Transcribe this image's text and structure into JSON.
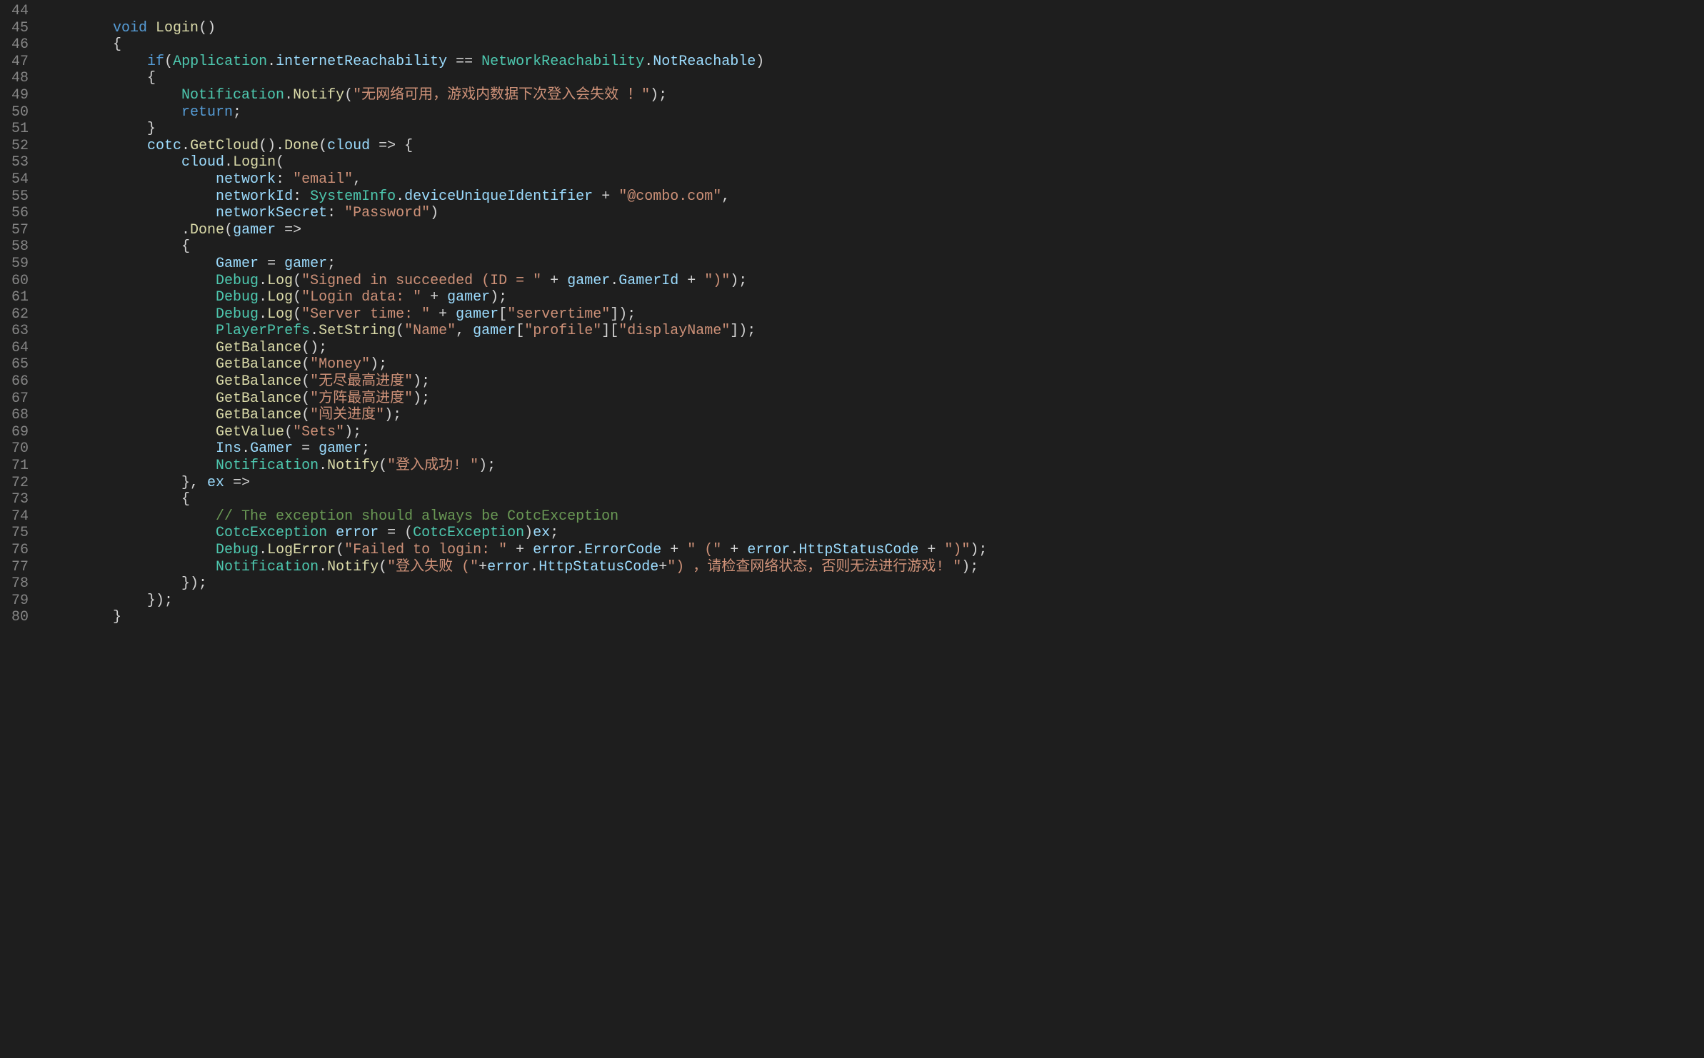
{
  "gutter": {
    "start": 44,
    "end": 80
  },
  "code": {
    "lines": [
      [
        {
          "t": "",
          "c": "punc"
        }
      ],
      [
        {
          "t": "        ",
          "c": "punc"
        },
        {
          "t": "void",
          "c": "kw"
        },
        {
          "t": " ",
          "c": "punc"
        },
        {
          "t": "Login",
          "c": "fn"
        },
        {
          "t": "()",
          "c": "punc"
        }
      ],
      [
        {
          "t": "        {",
          "c": "punc"
        }
      ],
      [
        {
          "t": "            ",
          "c": "punc"
        },
        {
          "t": "if",
          "c": "kw"
        },
        {
          "t": "(",
          "c": "punc"
        },
        {
          "t": "Application",
          "c": "type"
        },
        {
          "t": ".",
          "c": "punc"
        },
        {
          "t": "internetReachability",
          "c": "prop"
        },
        {
          "t": " == ",
          "c": "op"
        },
        {
          "t": "NetworkReachability",
          "c": "enum"
        },
        {
          "t": ".",
          "c": "punc"
        },
        {
          "t": "NotReachable",
          "c": "enumval"
        },
        {
          "t": ")",
          "c": "punc"
        }
      ],
      [
        {
          "t": "            {",
          "c": "punc"
        }
      ],
      [
        {
          "t": "                ",
          "c": "punc"
        },
        {
          "t": "Notification",
          "c": "type"
        },
        {
          "t": ".",
          "c": "punc"
        },
        {
          "t": "Notify",
          "c": "fn"
        },
        {
          "t": "(",
          "c": "punc"
        },
        {
          "t": "\"无网络可用，游戏内数据下次登入会失效 ！\"",
          "c": "str"
        },
        {
          "t": ");",
          "c": "punc"
        }
      ],
      [
        {
          "t": "                ",
          "c": "punc"
        },
        {
          "t": "return",
          "c": "kw"
        },
        {
          "t": ";",
          "c": "punc"
        }
      ],
      [
        {
          "t": "            }",
          "c": "punc"
        }
      ],
      [
        {
          "t": "            ",
          "c": "punc"
        },
        {
          "t": "cotc",
          "c": "var"
        },
        {
          "t": ".",
          "c": "punc"
        },
        {
          "t": "GetCloud",
          "c": "fn"
        },
        {
          "t": "().",
          "c": "punc"
        },
        {
          "t": "Done",
          "c": "fn"
        },
        {
          "t": "(",
          "c": "punc"
        },
        {
          "t": "cloud",
          "c": "var"
        },
        {
          "t": " => {",
          "c": "punc"
        }
      ],
      [
        {
          "t": "                ",
          "c": "punc"
        },
        {
          "t": "cloud",
          "c": "var"
        },
        {
          "t": ".",
          "c": "punc"
        },
        {
          "t": "Login",
          "c": "fn"
        },
        {
          "t": "(",
          "c": "punc"
        }
      ],
      [
        {
          "t": "                    ",
          "c": "punc"
        },
        {
          "t": "network",
          "c": "param"
        },
        {
          "t": ": ",
          "c": "punc"
        },
        {
          "t": "\"email\"",
          "c": "str"
        },
        {
          "t": ",",
          "c": "punc"
        }
      ],
      [
        {
          "t": "                    ",
          "c": "punc"
        },
        {
          "t": "networkId",
          "c": "param"
        },
        {
          "t": ": ",
          "c": "punc"
        },
        {
          "t": "SystemInfo",
          "c": "type"
        },
        {
          "t": ".",
          "c": "punc"
        },
        {
          "t": "deviceUniqueIdentifier",
          "c": "prop"
        },
        {
          "t": " + ",
          "c": "op"
        },
        {
          "t": "\"@combo.com\"",
          "c": "str"
        },
        {
          "t": ",",
          "c": "punc"
        }
      ],
      [
        {
          "t": "                    ",
          "c": "punc"
        },
        {
          "t": "networkSecret",
          "c": "param"
        },
        {
          "t": ": ",
          "c": "punc"
        },
        {
          "t": "\"Password\"",
          "c": "str"
        },
        {
          "t": ")",
          "c": "punc"
        }
      ],
      [
        {
          "t": "                .",
          "c": "punc"
        },
        {
          "t": "Done",
          "c": "fn"
        },
        {
          "t": "(",
          "c": "punc"
        },
        {
          "t": "gamer",
          "c": "var"
        },
        {
          "t": " =>",
          "c": "punc"
        }
      ],
      [
        {
          "t": "                {",
          "c": "punc"
        }
      ],
      [
        {
          "t": "                    ",
          "c": "punc"
        },
        {
          "t": "Gamer",
          "c": "var"
        },
        {
          "t": " = ",
          "c": "op"
        },
        {
          "t": "gamer",
          "c": "var"
        },
        {
          "t": ";",
          "c": "punc"
        }
      ],
      [
        {
          "t": "                    ",
          "c": "punc"
        },
        {
          "t": "Debug",
          "c": "type"
        },
        {
          "t": ".",
          "c": "punc"
        },
        {
          "t": "Log",
          "c": "fn"
        },
        {
          "t": "(",
          "c": "punc"
        },
        {
          "t": "\"Signed in succeeded (ID = \"",
          "c": "str"
        },
        {
          "t": " + ",
          "c": "op"
        },
        {
          "t": "gamer",
          "c": "var"
        },
        {
          "t": ".",
          "c": "punc"
        },
        {
          "t": "GamerId",
          "c": "prop"
        },
        {
          "t": " + ",
          "c": "op"
        },
        {
          "t": "\")\"",
          "c": "str"
        },
        {
          "t": ");",
          "c": "punc"
        }
      ],
      [
        {
          "t": "                    ",
          "c": "punc"
        },
        {
          "t": "Debug",
          "c": "type"
        },
        {
          "t": ".",
          "c": "punc"
        },
        {
          "t": "Log",
          "c": "fn"
        },
        {
          "t": "(",
          "c": "punc"
        },
        {
          "t": "\"Login data: \"",
          "c": "str"
        },
        {
          "t": " + ",
          "c": "op"
        },
        {
          "t": "gamer",
          "c": "var"
        },
        {
          "t": ");",
          "c": "punc"
        }
      ],
      [
        {
          "t": "                    ",
          "c": "punc"
        },
        {
          "t": "Debug",
          "c": "type"
        },
        {
          "t": ".",
          "c": "punc"
        },
        {
          "t": "Log",
          "c": "fn"
        },
        {
          "t": "(",
          "c": "punc"
        },
        {
          "t": "\"Server time: \"",
          "c": "str"
        },
        {
          "t": " + ",
          "c": "op"
        },
        {
          "t": "gamer",
          "c": "var"
        },
        {
          "t": "[",
          "c": "punc"
        },
        {
          "t": "\"servertime\"",
          "c": "str"
        },
        {
          "t": "]);",
          "c": "punc"
        }
      ],
      [
        {
          "t": "                    ",
          "c": "punc"
        },
        {
          "t": "PlayerPrefs",
          "c": "type"
        },
        {
          "t": ".",
          "c": "punc"
        },
        {
          "t": "SetString",
          "c": "fn"
        },
        {
          "t": "(",
          "c": "punc"
        },
        {
          "t": "\"Name\"",
          "c": "str"
        },
        {
          "t": ", ",
          "c": "punc"
        },
        {
          "t": "gamer",
          "c": "var"
        },
        {
          "t": "[",
          "c": "punc"
        },
        {
          "t": "\"profile\"",
          "c": "str"
        },
        {
          "t": "][",
          "c": "punc"
        },
        {
          "t": "\"displayName\"",
          "c": "str"
        },
        {
          "t": "]);",
          "c": "punc"
        }
      ],
      [
        {
          "t": "                    ",
          "c": "punc"
        },
        {
          "t": "GetBalance",
          "c": "fn"
        },
        {
          "t": "();",
          "c": "punc"
        }
      ],
      [
        {
          "t": "                    ",
          "c": "punc"
        },
        {
          "t": "GetBalance",
          "c": "fn"
        },
        {
          "t": "(",
          "c": "punc"
        },
        {
          "t": "\"Money\"",
          "c": "str"
        },
        {
          "t": ");",
          "c": "punc"
        }
      ],
      [
        {
          "t": "                    ",
          "c": "punc"
        },
        {
          "t": "GetBalance",
          "c": "fn"
        },
        {
          "t": "(",
          "c": "punc"
        },
        {
          "t": "\"无尽最高进度\"",
          "c": "str"
        },
        {
          "t": ");",
          "c": "punc"
        }
      ],
      [
        {
          "t": "                    ",
          "c": "punc"
        },
        {
          "t": "GetBalance",
          "c": "fn"
        },
        {
          "t": "(",
          "c": "punc"
        },
        {
          "t": "\"方阵最高进度\"",
          "c": "str"
        },
        {
          "t": ");",
          "c": "punc"
        }
      ],
      [
        {
          "t": "                    ",
          "c": "punc"
        },
        {
          "t": "GetBalance",
          "c": "fn"
        },
        {
          "t": "(",
          "c": "punc"
        },
        {
          "t": "\"闯关进度\"",
          "c": "str"
        },
        {
          "t": ");",
          "c": "punc"
        }
      ],
      [
        {
          "t": "                    ",
          "c": "punc"
        },
        {
          "t": "GetValue",
          "c": "fn"
        },
        {
          "t": "(",
          "c": "punc"
        },
        {
          "t": "\"Sets\"",
          "c": "str"
        },
        {
          "t": ");",
          "c": "punc"
        }
      ],
      [
        {
          "t": "                    ",
          "c": "punc"
        },
        {
          "t": "Ins",
          "c": "var"
        },
        {
          "t": ".",
          "c": "punc"
        },
        {
          "t": "Gamer",
          "c": "prop"
        },
        {
          "t": " = ",
          "c": "op"
        },
        {
          "t": "gamer",
          "c": "var"
        },
        {
          "t": ";",
          "c": "punc"
        }
      ],
      [
        {
          "t": "                    ",
          "c": "punc"
        },
        {
          "t": "Notification",
          "c": "type"
        },
        {
          "t": ".",
          "c": "punc"
        },
        {
          "t": "Notify",
          "c": "fn"
        },
        {
          "t": "(",
          "c": "punc"
        },
        {
          "t": "\"登入成功! \"",
          "c": "str"
        },
        {
          "t": ");",
          "c": "punc"
        }
      ],
      [
        {
          "t": "                }, ",
          "c": "punc"
        },
        {
          "t": "ex",
          "c": "var"
        },
        {
          "t": " =>",
          "c": "punc"
        }
      ],
      [
        {
          "t": "                {",
          "c": "punc"
        }
      ],
      [
        {
          "t": "                    ",
          "c": "punc"
        },
        {
          "t": "// The exception should always be CotcException",
          "c": "cmt"
        }
      ],
      [
        {
          "t": "                    ",
          "c": "punc"
        },
        {
          "t": "CotcException",
          "c": "type"
        },
        {
          "t": " ",
          "c": "punc"
        },
        {
          "t": "error",
          "c": "var"
        },
        {
          "t": " = (",
          "c": "punc"
        },
        {
          "t": "CotcException",
          "c": "type"
        },
        {
          "t": ")",
          "c": "punc"
        },
        {
          "t": "ex",
          "c": "var"
        },
        {
          "t": ";",
          "c": "punc"
        }
      ],
      [
        {
          "t": "                    ",
          "c": "punc"
        },
        {
          "t": "Debug",
          "c": "type"
        },
        {
          "t": ".",
          "c": "punc"
        },
        {
          "t": "LogError",
          "c": "fn"
        },
        {
          "t": "(",
          "c": "punc"
        },
        {
          "t": "\"Failed to login: \"",
          "c": "str"
        },
        {
          "t": " + ",
          "c": "op"
        },
        {
          "t": "error",
          "c": "var"
        },
        {
          "t": ".",
          "c": "punc"
        },
        {
          "t": "ErrorCode",
          "c": "prop"
        },
        {
          "t": " + ",
          "c": "op"
        },
        {
          "t": "\" (\"",
          "c": "str"
        },
        {
          "t": " + ",
          "c": "op"
        },
        {
          "t": "error",
          "c": "var"
        },
        {
          "t": ".",
          "c": "punc"
        },
        {
          "t": "HttpStatusCode",
          "c": "prop"
        },
        {
          "t": " + ",
          "c": "op"
        },
        {
          "t": "\")\"",
          "c": "str"
        },
        {
          "t": ");",
          "c": "punc"
        }
      ],
      [
        {
          "t": "                    ",
          "c": "punc"
        },
        {
          "t": "Notification",
          "c": "type"
        },
        {
          "t": ".",
          "c": "punc"
        },
        {
          "t": "Notify",
          "c": "fn"
        },
        {
          "t": "(",
          "c": "punc"
        },
        {
          "t": "\"登入失败 (\"",
          "c": "str"
        },
        {
          "t": "+",
          "c": "op"
        },
        {
          "t": "error",
          "c": "var"
        },
        {
          "t": ".",
          "c": "punc"
        },
        {
          "t": "HttpStatusCode",
          "c": "prop"
        },
        {
          "t": "+",
          "c": "op"
        },
        {
          "t": "\") ，请检查网络状态，否则无法进行游戏! \"",
          "c": "str"
        },
        {
          "t": ");",
          "c": "punc"
        }
      ],
      [
        {
          "t": "                });",
          "c": "punc"
        }
      ],
      [
        {
          "t": "            });",
          "c": "punc"
        }
      ],
      [
        {
          "t": "        }",
          "c": "punc"
        }
      ]
    ]
  }
}
